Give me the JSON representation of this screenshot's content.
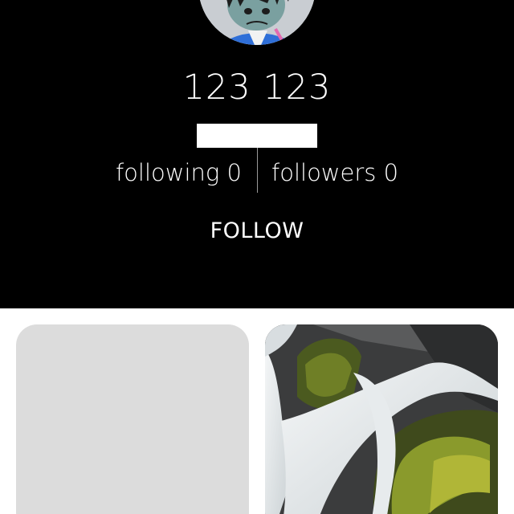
{
  "profile": {
    "display_name": "123 123",
    "following": "following 0",
    "followers": "followers 0",
    "follow_label": "FOLLOW",
    "avatar_icon": "cartoon-character-avatar"
  },
  "colors": {
    "header_background": "#000000",
    "header_text": "#ffffff",
    "page_background": "#ffffff",
    "placeholder_card": "#dcdcdc"
  },
  "posts": [
    {
      "kind": "placeholder"
    },
    {
      "kind": "photo",
      "subject": "waterfall-over-mossy-rocks"
    }
  ]
}
